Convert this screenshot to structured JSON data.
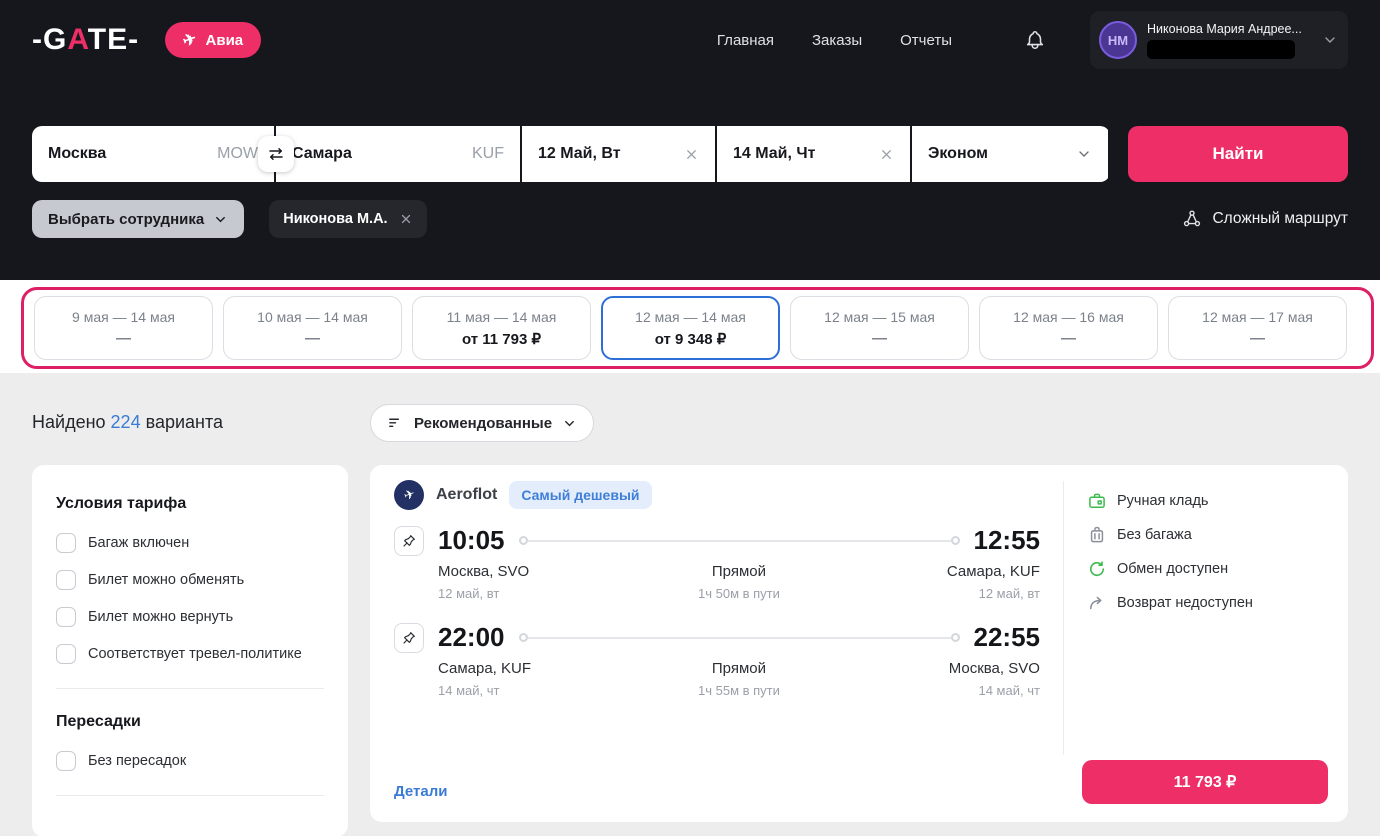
{
  "colors": {
    "accent_pink": "#ED2E67",
    "selected_blue": "#2D6FD6",
    "link_blue": "#3A7BD5",
    "ok_green": "#3DBA4E"
  },
  "header": {
    "logo": {
      "pre": "-G",
      "a": "A",
      "post": "TE-"
    },
    "product_badge": "Авиа",
    "nav": [
      {
        "label": "Главная"
      },
      {
        "label": "Заказы"
      },
      {
        "label": "Отчеты"
      }
    ],
    "user": {
      "initials": "НМ",
      "name": "Никонова Мария Андрее..."
    }
  },
  "search": {
    "from": {
      "city": "Москва",
      "code": "MOW"
    },
    "to": {
      "city": "Самара",
      "code": "KUF"
    },
    "depart": "12 Май, Вт",
    "return": "14 Май, Чт",
    "cabin": "Эконом",
    "submit": "Найти",
    "select_employee": "Выбрать сотрудника",
    "employee": "Никонова М.А.",
    "complex_route": "Сложный маршрут"
  },
  "date_matrix": {
    "options": [
      {
        "range": "9 мая — 14 мая",
        "price": "—"
      },
      {
        "range": "10 мая — 14 мая",
        "price": "—"
      },
      {
        "range": "11 мая — 14 мая",
        "price": "от 11 793 ₽"
      },
      {
        "range": "12 мая — 14 мая",
        "price": "от 9 348 ₽"
      },
      {
        "range": "12 мая — 15 мая",
        "price": "—"
      },
      {
        "range": "12 мая — 16 мая",
        "price": "—"
      },
      {
        "range": "12 мая — 17 мая",
        "price": "—"
      }
    ]
  },
  "results": {
    "found_prefix": "Найдено",
    "count": "224",
    "found_suffix": "варианта",
    "sort_label": "Рекомендованные"
  },
  "filters": {
    "tariff_title": "Условия тарифа",
    "tariff_options": [
      {
        "label": "Багаж включен"
      },
      {
        "label": "Билет можно обменять"
      },
      {
        "label": "Билет можно вернуть"
      },
      {
        "label": "Соответствует тревел-политике"
      }
    ],
    "transfers_title": "Пересадки",
    "transfer_options": [
      {
        "label": "Без пересадок"
      }
    ]
  },
  "flight": {
    "airline": "Aeroflot",
    "badge": "Самый дешевый",
    "segments": [
      {
        "dep_time": "10:05",
        "arr_time": "12:55",
        "dep_place": "Москва, SVO",
        "dep_date": "12 май, вт",
        "type": "Прямой",
        "duration": "1ч 50м в пути",
        "arr_place": "Самара, KUF",
        "arr_date": "12 май, вт"
      },
      {
        "dep_time": "22:00",
        "arr_time": "22:55",
        "dep_place": "Самара, KUF",
        "dep_date": "14 май, чт",
        "type": "Прямой",
        "duration": "1ч 55м в пути",
        "arr_place": "Москва, SVO",
        "arr_date": "14 май, чт"
      }
    ],
    "details_link": "Детали",
    "conditions": [
      {
        "label": "Ручная кладь"
      },
      {
        "label": "Без багажа"
      },
      {
        "label": "Обмен доступен"
      },
      {
        "label": "Возврат недоступен"
      }
    ],
    "price": "11 793 ₽"
  }
}
